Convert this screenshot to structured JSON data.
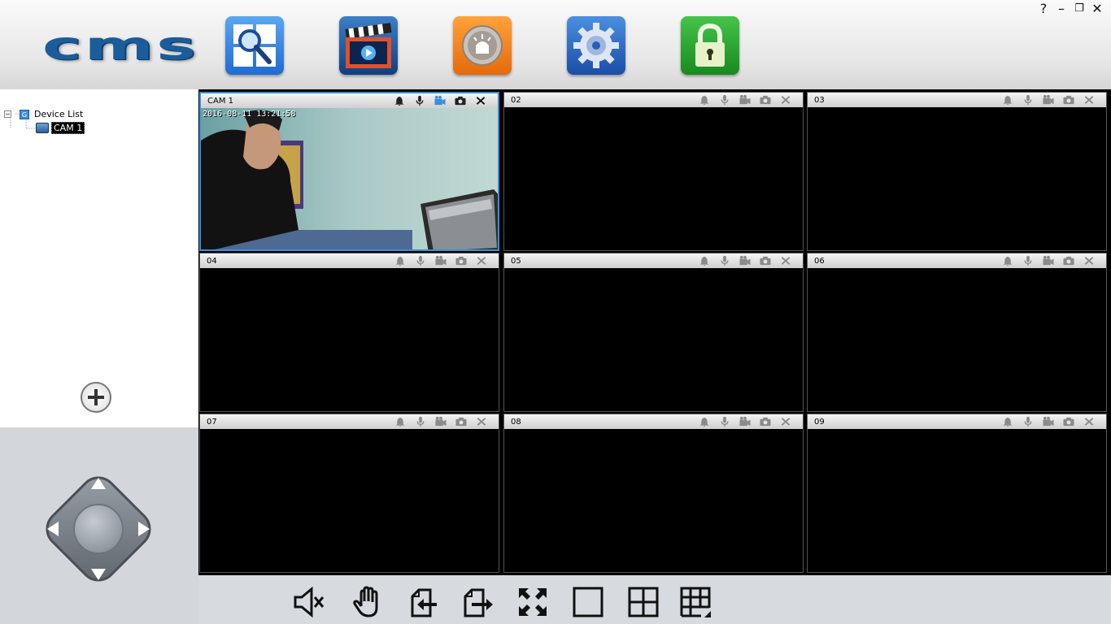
{
  "app": {
    "logo_text": "CMS"
  },
  "toolbar": {
    "icons": [
      "search-playback-icon",
      "video-clip-icon",
      "alarm-icon",
      "settings-gear-icon",
      "lock-icon"
    ]
  },
  "window_controls": {
    "help": "?",
    "minimize": "–",
    "restore": "❐",
    "close": "✕"
  },
  "device_tree": {
    "root_toggle": "−",
    "root_label": "Device List",
    "root_badge": "G",
    "child_label": "CAM 1"
  },
  "cameras": [
    {
      "title": "CAM 1",
      "osd": "2016-08-11 13:21:58",
      "live": true
    },
    {
      "title": "02",
      "live": false
    },
    {
      "title": "03",
      "live": false
    },
    {
      "title": "04",
      "live": false
    },
    {
      "title": "05",
      "live": false
    },
    {
      "title": "06",
      "live": false
    },
    {
      "title": "07",
      "live": false
    },
    {
      "title": "08",
      "live": false
    },
    {
      "title": "09",
      "live": false
    }
  ],
  "bottom_tools": [
    "mute-icon",
    "hand-icon",
    "previous-page-icon",
    "next-page-icon",
    "fullscreen-icon",
    "single-view-icon",
    "quad-view-icon",
    "nine-view-icon"
  ],
  "colors": {
    "accent": "#3a8fd8",
    "logo": "#1b5c9a"
  }
}
